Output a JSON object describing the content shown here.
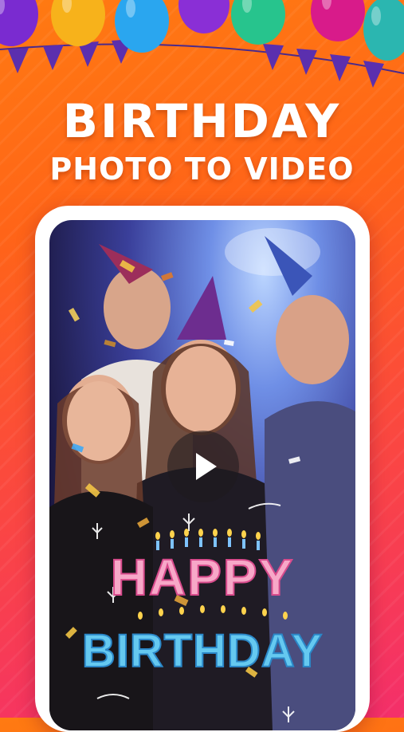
{
  "headline": {
    "line1": "BIRTHDAY",
    "line2": "PHOTO TO VIDEO"
  },
  "preview": {
    "overlay_text_line1": "HAPPY",
    "overlay_text_line2": "BIRTHDAY",
    "play_icon": "play-icon"
  },
  "colors": {
    "background_top": "#ff7a12",
    "background_bottom": "#f42f6a",
    "frame": "#ffffff"
  }
}
